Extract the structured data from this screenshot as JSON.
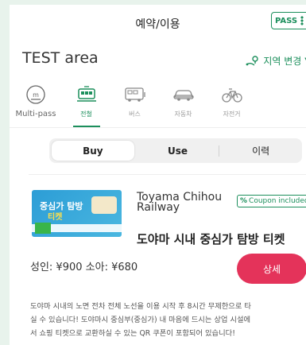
{
  "header": {
    "title": "예약/이용",
    "pass_badge": "PASS"
  },
  "area": {
    "name": "TEST area",
    "change_label": "지역 변경"
  },
  "modes": [
    {
      "label": "Multi-pass",
      "icon": "multi-pass-icon"
    },
    {
      "label": "전철",
      "icon": "train-icon",
      "active": true
    },
    {
      "label": "버스",
      "icon": "bus-icon"
    },
    {
      "label": "자동차",
      "icon": "car-icon"
    },
    {
      "label": "자전거",
      "icon": "bicycle-icon"
    }
  ],
  "tabs": {
    "buy": "Buy",
    "use": "Use",
    "history": "이력"
  },
  "ticket": {
    "company_line1": "Toyama Chihou",
    "company_line2": "Railway",
    "coupon_label": "Coupon included",
    "name": "도야마 시내 중심가 탐방 티켓",
    "price": "성인: ¥900 소아: ¥680",
    "detail_button": "상세",
    "image_title": "중심가 탐방",
    "image_subtitle": "티켓",
    "description_lines": [
      "도야마 시내의 노면 전차 전체 노선을 이용 시작 후 8시간 무제한으로 타",
      "실 수 있습니다! 도야마시 중심부(중심가) 내 마음에 드시는 상업 시설에",
      "서 쇼핑 티켓으로 교환하실 수 있는 QR 쿠폰이 포함되어 있습니다!"
    ]
  },
  "colors": {
    "accent": "#1c8f5c",
    "button": "#e4335a",
    "background": "#e8f3ec"
  }
}
